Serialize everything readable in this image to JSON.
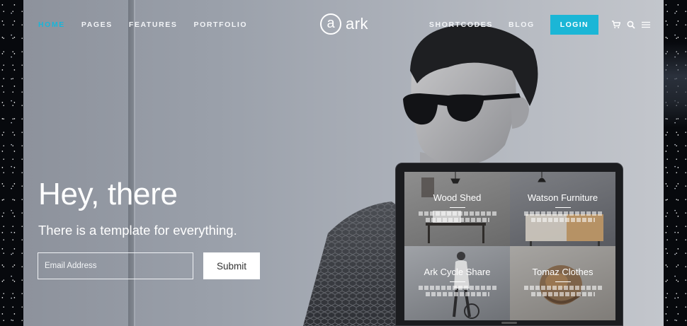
{
  "nav": {
    "left": [
      {
        "label": "HOME",
        "active": true
      },
      {
        "label": "PAGES",
        "active": false
      },
      {
        "label": "FEATURES",
        "active": false
      },
      {
        "label": "PORTFOLIO",
        "active": false
      }
    ],
    "logo": {
      "mark": "a",
      "text": "ark"
    },
    "right": [
      {
        "label": "SHORTCODES"
      },
      {
        "label": "BLOG"
      }
    ],
    "login_label": "LOGIN",
    "icons": [
      "cart-icon",
      "search-icon",
      "menu-icon"
    ]
  },
  "hero": {
    "headline": "Hey, there",
    "subline": "There is a template for everything.",
    "email_placeholder": "Email Address",
    "submit_label": "Submit"
  },
  "laptop": {
    "tiles": [
      {
        "title": "Wood Shed"
      },
      {
        "title": "Watson Furniture"
      },
      {
        "title": "Ark Cycle Share"
      },
      {
        "title": "Tomaz Clothes"
      }
    ]
  },
  "colors": {
    "accent": "#1bb6d6",
    "active_nav": "#1ab5d8"
  }
}
